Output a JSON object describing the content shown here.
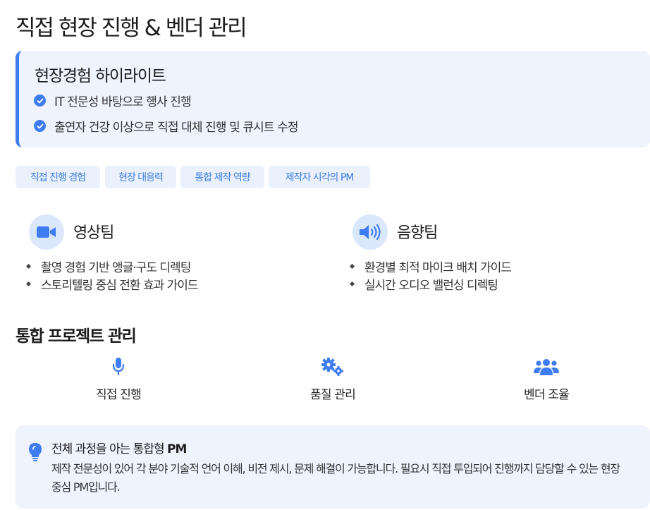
{
  "page": {
    "title": "직접 현장 진행 & 벤더 관리"
  },
  "highlight": {
    "title": "현장경험 하이라이트",
    "items": [
      "IT 전문성 바탕으로 행사 진행",
      "출연자 건강 이상으로 직접 대체 진행 및 큐시트 수정"
    ]
  },
  "tags": [
    "직접 진행 경험",
    "현장 대응력",
    "통합 제작 역량",
    "제작자 시각의 PM"
  ],
  "teams": [
    {
      "icon": "video-camera-icon",
      "title": "영상팀",
      "bullets": [
        "촬영 경험 기반 앵글·구도 디렉팅",
        "스토리텔링 중심 전환 효과 가이드"
      ]
    },
    {
      "icon": "speaker-volume-icon",
      "title": "음향팀",
      "bullets": [
        "환경별 최적 마이크 배치 가이드",
        "실시간 오디오 밸런싱 디렉팅"
      ]
    }
  ],
  "pm_section": {
    "title": "통합 프로젝트 관리",
    "items": [
      {
        "icon": "microphone-icon",
        "label": "직접 진행"
      },
      {
        "icon": "gears-icon",
        "label": "품질 관리"
      },
      {
        "icon": "users-icon",
        "label": "벤더 조율"
      }
    ]
  },
  "tip": {
    "icon": "lightbulb-icon",
    "title_prefix": "전체 과정을 아는 통합형 ",
    "title_bold": "PM",
    "body": "제작 전문성이 있어 각 분야 기술적 언어 이해, 비전 제시, 문제 해결이 가능합니다. 필요시 직접 투입되어 진행까지 담당할 수 있는 현장 중심 PM입니다."
  },
  "colors": {
    "accent": "#3d7cf2",
    "panel_bg": "#eef3fd",
    "tag_bg": "#eaf1fc",
    "tag_text": "#3b7de0",
    "icon_circle_bg": "#dbe7fb"
  }
}
